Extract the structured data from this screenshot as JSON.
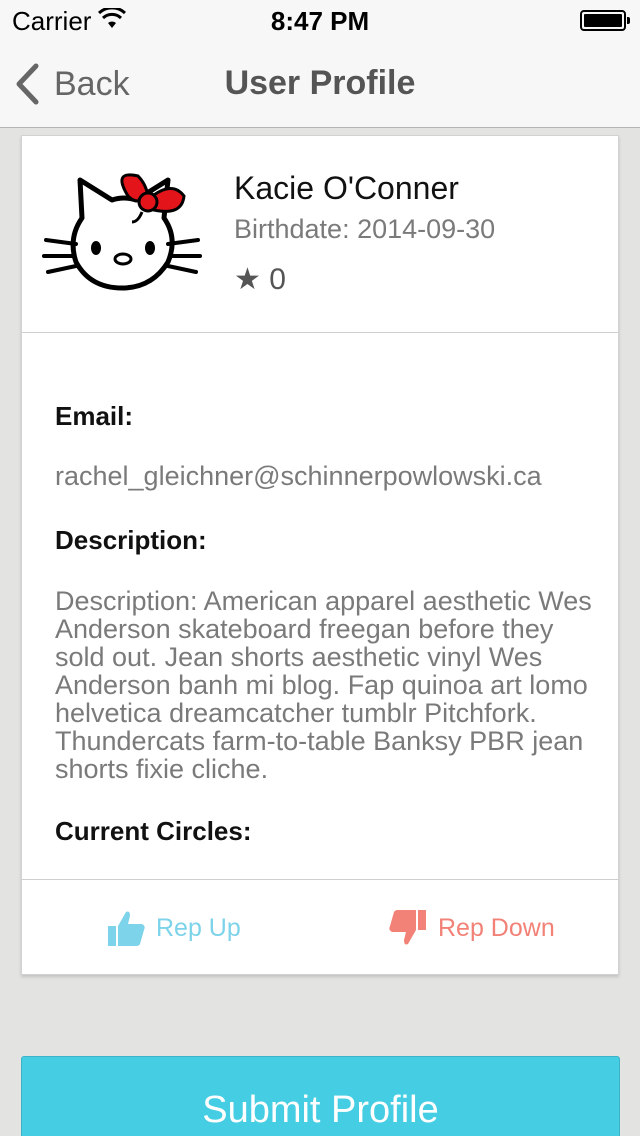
{
  "status_bar": {
    "carrier": "Carrier",
    "time": "8:47 PM"
  },
  "nav": {
    "back_label": "Back",
    "title": "User Profile"
  },
  "profile": {
    "name": "Kacie O'Conner",
    "birthdate": "Birthdate: 2014-09-30",
    "rep_count": "★ 0",
    "avatar_icon": "hello-kitty-avatar"
  },
  "details": {
    "email_label": "Email:",
    "email_value": "rachel_gleichner@schinnerpowlowski.ca",
    "description_label": "Description:",
    "description_value": "Description: American apparel aesthetic Wes Anderson skateboard freegan before they sold out. Jean shorts aesthetic vinyl Wes Anderson banh mi blog. Fap quinoa art lomo helvetica dreamcatcher tumblr Pitchfork. Thundercats farm-to-table Banksy PBR jean shorts fixie cliche.",
    "circles_label": "Current Circles:"
  },
  "actions": {
    "rep_up_label": "Rep Up",
    "rep_up_icon": "thumbs-up-icon",
    "rep_down_label": "Rep Down",
    "rep_down_icon": "thumbs-down-icon",
    "submit_label": "Submit Profile"
  },
  "colors": {
    "accent": "#45cde3",
    "rep_up": "#7dd3ea",
    "rep_down": "#f28277",
    "background": "#e3e4e2"
  }
}
